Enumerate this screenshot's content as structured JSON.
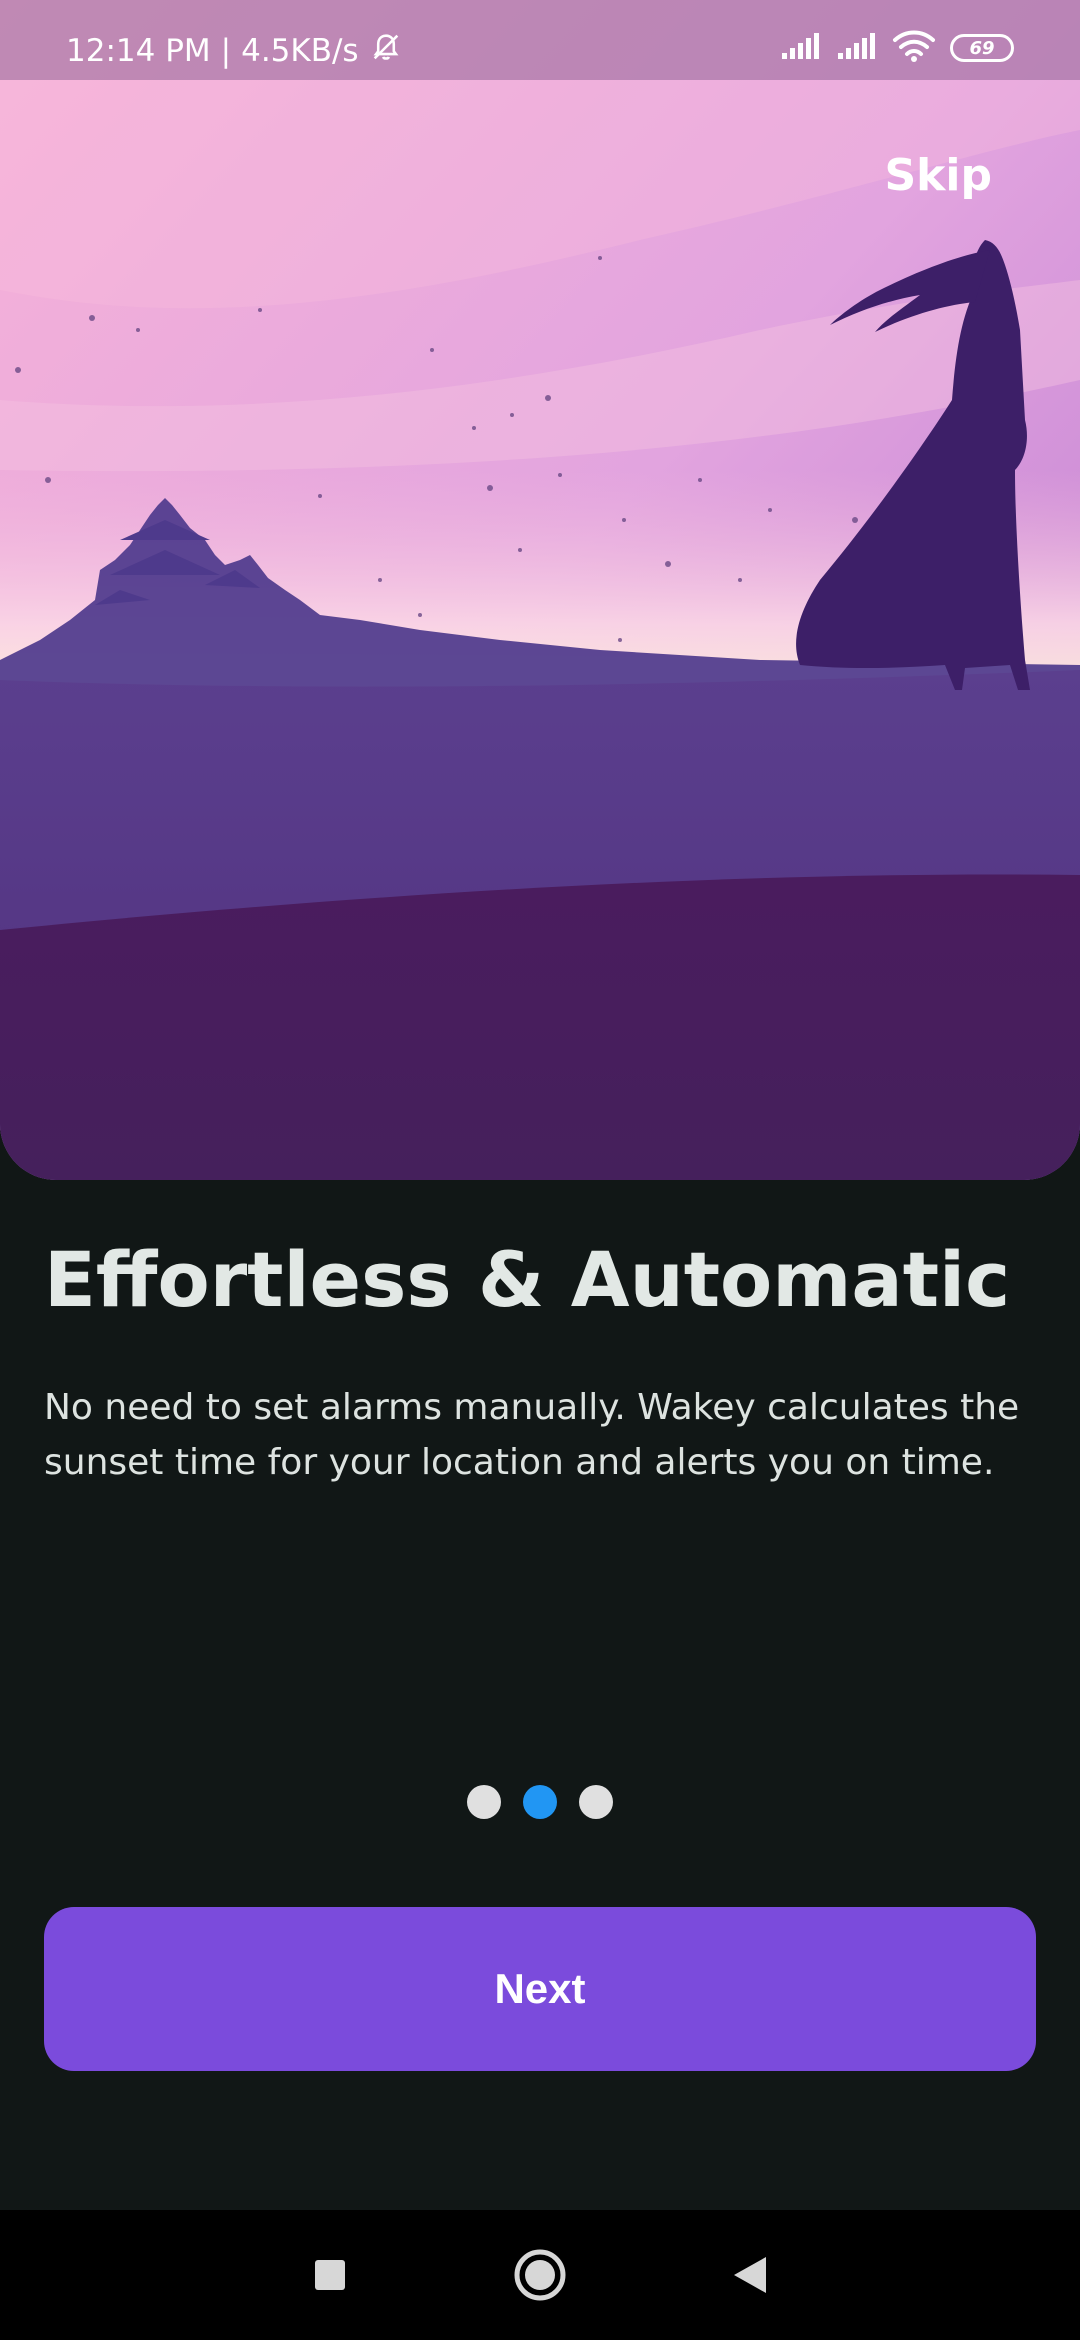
{
  "status_bar": {
    "time": "12:14 PM",
    "separator": "|",
    "network_speed": "4.5KB/s",
    "battery_level": "69",
    "icons": [
      "alarm-off-icon",
      "signal-icon",
      "signal-icon",
      "wifi-icon",
      "battery-icon"
    ]
  },
  "hero": {
    "skip_label": "Skip",
    "colors": {
      "sky_top": "#f2a9d6",
      "sky_mid": "#d8a0e0",
      "horizon": "#fde2d8",
      "ground": "#5a3787",
      "ground_dark": "#44195a"
    }
  },
  "onboarding": {
    "title": "Effortless & Automatic",
    "description": "No need to set alarms manually. Wakey calculates the sunset time for your location and alerts you on time.",
    "page_count": 3,
    "active_page": 2,
    "next_label": "Next",
    "accent_color": "#7b4bdc",
    "dot_active_color": "#2196f3"
  },
  "nav_bar": {
    "icons": [
      "recents-square-icon",
      "home-circle-icon",
      "back-triangle-icon"
    ]
  }
}
